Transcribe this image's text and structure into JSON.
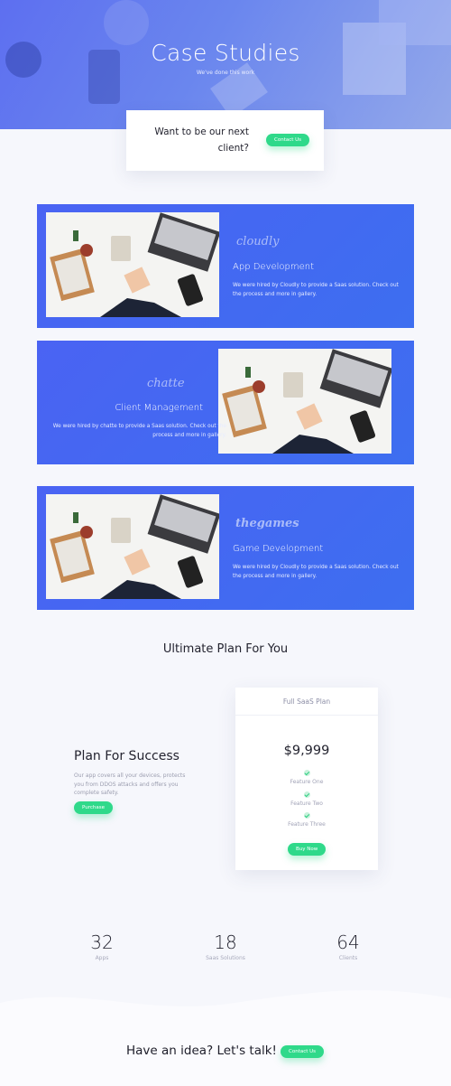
{
  "hero": {
    "title": "Case Studies",
    "subtitle": "We've done this work"
  },
  "cta": {
    "line1": "Want to be our next",
    "line2": "client?",
    "button": "Contact Us"
  },
  "cases": [
    {
      "logo": "cloudly",
      "title": "App Development",
      "desc": "We were hired by Cloudly to provide a Saas solution. Check out the process  and more in gallery."
    },
    {
      "logo": "chatte",
      "title": "Client Management",
      "desc": "We were hired by chatte to provide a Saas solution. Check out the process  and more in gallery."
    },
    {
      "logo": "thegames",
      "title": "Game Development",
      "desc": "We were hired by Cloudly to provide a Saas solution. Check out the process  and more in gallery."
    }
  ],
  "plan": {
    "heading": "Ultimate Plan For You",
    "left_title": "Plan For Success",
    "left_desc": "Our app covers all your devices, protects you from DDOS attacks and offers you complete safety.",
    "left_button": "Purchase",
    "card": {
      "name": "Full SaaS Plan",
      "price": "$9,999",
      "features": [
        "Feature One",
        "Feature Two",
        "Feature Three"
      ],
      "button": "Buy Now"
    }
  },
  "stats": [
    {
      "num": "32",
      "label": "Apps"
    },
    {
      "num": "18",
      "label": "Saas Solutions"
    },
    {
      "num": "64",
      "label": "Clients"
    }
  ],
  "footer_cta": {
    "text": "Have an idea? Let's talk!",
    "button": "Contact Us"
  },
  "colors": {
    "accent_green": "#2fd98a",
    "brand_blue": "#4a63f3"
  }
}
